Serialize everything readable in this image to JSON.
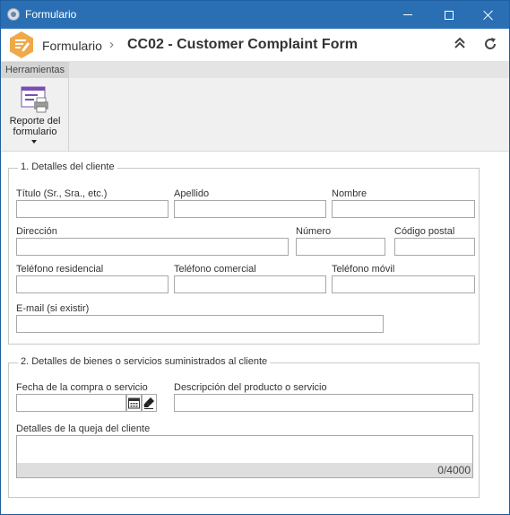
{
  "window": {
    "title": "Formulario"
  },
  "header": {
    "breadcrumb": "Formulario",
    "separator": "›",
    "page_title": "CC02 - Customer Complaint Form",
    "collapse_icon": "double-chevron-up-icon",
    "refresh_icon": "refresh-icon",
    "accent_color": "#f0a94a",
    "titlebar_color": "#2a6fb3"
  },
  "toolbar": {
    "section_label": "Herramientas",
    "report_button_label": "Reporte del formulario"
  },
  "section1": {
    "legend": "1. Detalles del cliente",
    "fields": {
      "titulo": "Título (Sr., Sra., etc.)",
      "apellido": "Apellido",
      "nombre": "Nombre",
      "direccion": "Dirección",
      "numero": "Número",
      "codigo_postal": "Código postal",
      "tel_residencial": "Teléfono residencial",
      "tel_comercial": "Teléfono comercial",
      "tel_movil": "Teléfono móvil",
      "email": "E-mail (si existir)"
    },
    "values": {
      "titulo": "",
      "apellido": "",
      "nombre": "",
      "direccion": "",
      "numero": "",
      "codigo_postal": "",
      "tel_residencial": "",
      "tel_comercial": "",
      "tel_movil": "",
      "email": ""
    }
  },
  "section2": {
    "legend": "2. Detalles de bienes o servicios suministrados al cliente",
    "fields": {
      "fecha_compra": "Fecha de la compra o servicio",
      "descripcion": "Descripción del producto o servicio",
      "detalles_queja": "Detalles de la queja del cliente"
    },
    "values": {
      "fecha_compra": "",
      "descripcion": "",
      "detalles_queja": ""
    },
    "char_counter": "0/4000"
  }
}
